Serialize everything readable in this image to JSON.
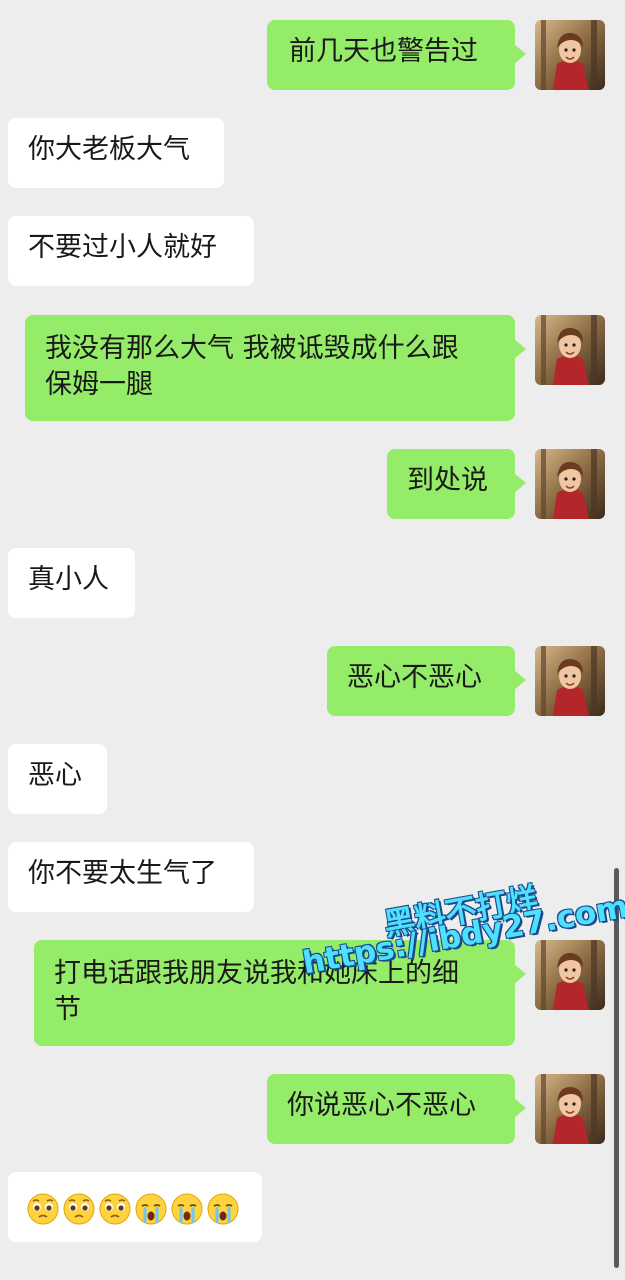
{
  "messages": [
    {
      "side": "out",
      "text": "前几天也警告过"
    },
    {
      "side": "in",
      "text": "你大老板大气"
    },
    {
      "side": "in",
      "text": "不要过小人就好"
    },
    {
      "side": "out",
      "text": "我没有那么大气 我被诋毁成什么跟\n保姆一腿"
    },
    {
      "side": "out",
      "text": "到处说"
    },
    {
      "side": "in",
      "text": "真小人"
    },
    {
      "side": "out",
      "text": "恶心不恶心"
    },
    {
      "side": "in",
      "text": "恶心"
    },
    {
      "side": "in",
      "text": "你不要太生气了"
    },
    {
      "side": "out",
      "text": "打电话跟我朋友说我和她床上的细\n节"
    },
    {
      "side": "out",
      "text": "你说恶心不恶心"
    },
    {
      "side": "in",
      "text": "",
      "emojis": [
        "pleading-face",
        "pleading-face",
        "pleading-face",
        "sobbing-face",
        "sobbing-face",
        "sobbing-face"
      ]
    }
  ],
  "watermark": {
    "line1": "黑料不打烊",
    "line2": "https://ibdy27.com"
  },
  "colors": {
    "background": "#ededed",
    "incoming": "#ffffff",
    "outgoing": "#95ec69",
    "watermark": "#4fe0ff"
  }
}
